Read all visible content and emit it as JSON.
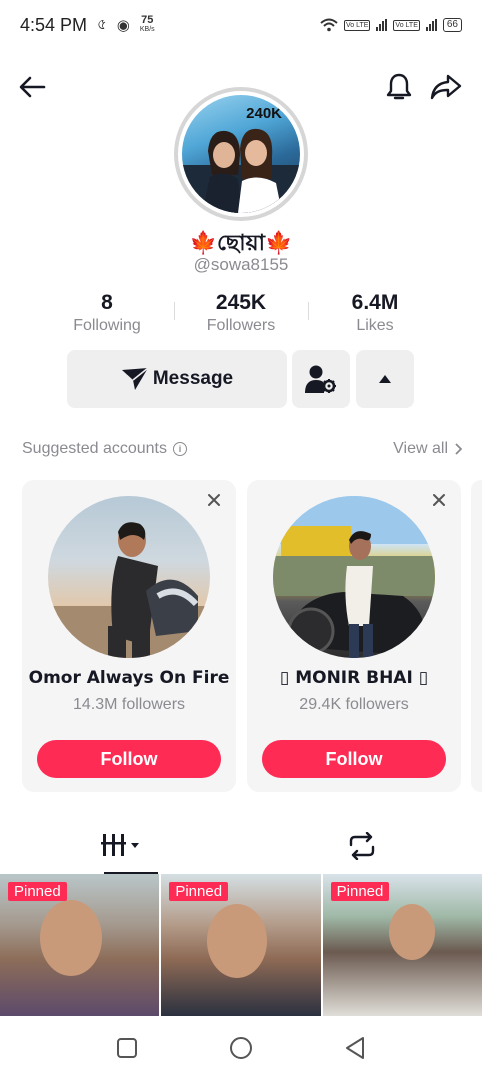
{
  "status_bar": {
    "time": "4:54 PM",
    "net_speed_value": "75",
    "net_speed_unit": "KB/s",
    "volte_1": "Vo LTE",
    "volte_2": "Vo LTE",
    "battery": "66"
  },
  "profile": {
    "avatar_badge": "240K",
    "display_name": "🍁ছোয়া🍁",
    "username": "@sowa8155",
    "stats": [
      {
        "value": "8",
        "label": "Following"
      },
      {
        "value": "245K",
        "label": "Followers"
      },
      {
        "value": "6.4M",
        "label": "Likes"
      }
    ],
    "message_label": "Message"
  },
  "suggested": {
    "title": "Suggested accounts",
    "view_all": "View all",
    "accounts": [
      {
        "name": "Omor Always On Fire",
        "followers": "14.3M followers",
        "follow_label": "Follow"
      },
      {
        "name": "▯ MONIR BHAI ▯",
        "followers": "29.4K followers",
        "follow_label": "Follow"
      }
    ]
  },
  "videos": [
    {
      "badge": "Pinned"
    },
    {
      "badge": "Pinned"
    },
    {
      "badge": "Pinned"
    }
  ],
  "icons": {
    "back": "back-arrow-icon",
    "bell": "bell-icon",
    "share": "share-icon",
    "friend_settings": "person-gear-icon",
    "more": "caret-up-icon",
    "videos_tab": "grid-videos-icon",
    "repost_tab": "repost-icon"
  },
  "colors": {
    "accent": "#fe2c55",
    "button_bg": "#efefef",
    "muted_text": "#8a8b91"
  }
}
